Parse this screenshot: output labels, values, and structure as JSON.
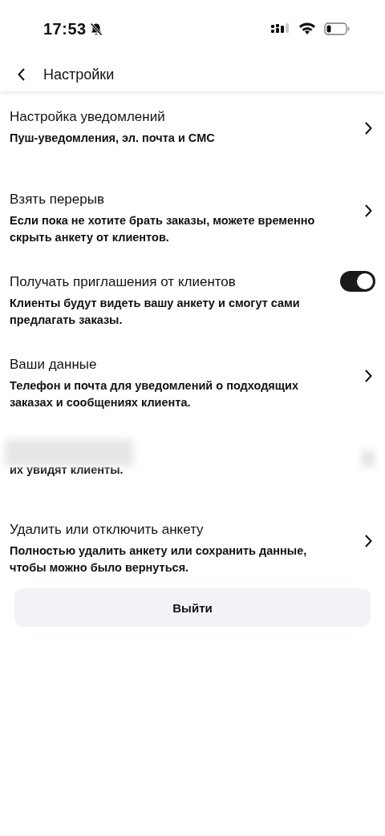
{
  "status_bar": {
    "time": "17:53",
    "silent": true
  },
  "header": {
    "title": "Настройки"
  },
  "settings": [
    {
      "kind": "chevron",
      "title": "Настройка уведомлений",
      "subtitle": "Пуш-уведомления, эл. почта и СМС"
    },
    {
      "kind": "chevron",
      "title": "Взять перерыв",
      "subtitle": "Если пока не хотите брать заказы, можете временно скрыть анкету от клиентов."
    },
    {
      "kind": "toggle",
      "title": "Получать приглашения от клиентов",
      "subtitle": "Клиенты будут видеть вашу анкету и смогут сами предлагать заказы.",
      "on": true
    },
    {
      "kind": "chevron",
      "title": "Ваши данные",
      "subtitle": "Телефон и почта для уведомлений о подходящих заказах и сообщениях клиента."
    },
    {
      "kind": "redacted",
      "subtitle": "их увидят клиенты."
    },
    {
      "kind": "chevron",
      "title": "Удалить или отключить анкету",
      "subtitle": "Полностью удалить анкету или сохранить данные, чтобы можно было вернуться."
    }
  ],
  "logout_button": "Выйти"
}
